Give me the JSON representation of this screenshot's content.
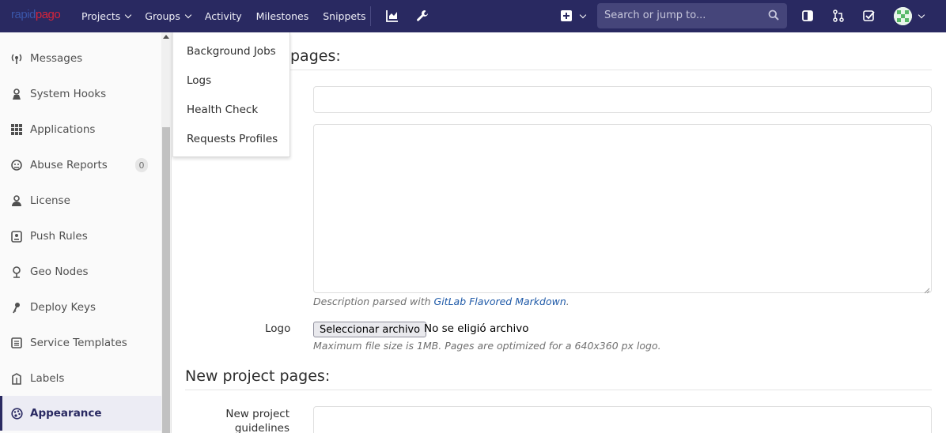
{
  "navbar": {
    "brand_prefix": "rapid",
    "brand_suffix": "pago",
    "items": [
      {
        "label": "Projects",
        "has_caret": true
      },
      {
        "label": "Groups",
        "has_caret": true
      },
      {
        "label": "Activity",
        "has_caret": false
      },
      {
        "label": "Milestones",
        "has_caret": false
      },
      {
        "label": "Snippets",
        "has_caret": false
      }
    ],
    "icons": [
      "chart-icon",
      "wrench-icon",
      "plus-square-icon",
      "chevron-down-icon",
      "sidebar-toggle-icon",
      "merge-request-icon",
      "todo-check-icon"
    ],
    "search_placeholder": "Search or jump to...",
    "colors": {
      "bg": "#292961",
      "search_bg": "#45457a"
    }
  },
  "sidebar": {
    "items": [
      {
        "label": "Messages",
        "icon": "broadcast-icon"
      },
      {
        "label": "System Hooks",
        "icon": "hook-icon"
      },
      {
        "label": "Applications",
        "icon": "grid-icon"
      },
      {
        "label": "Abuse Reports",
        "icon": "abuse-icon",
        "badge": "0"
      },
      {
        "label": "License",
        "icon": "license-icon"
      },
      {
        "label": "Push Rules",
        "icon": "push-rules-icon"
      },
      {
        "label": "Geo Nodes",
        "icon": "location-icon"
      },
      {
        "label": "Deploy Keys",
        "icon": "key-icon"
      },
      {
        "label": "Service Templates",
        "icon": "service-icon"
      },
      {
        "label": "Labels",
        "icon": "label-icon"
      },
      {
        "label": "Appearance",
        "icon": "palette-icon",
        "active": true
      }
    ]
  },
  "dropdown": {
    "items": [
      "Background Jobs",
      "Logs",
      "Health Check",
      "Requests Profiles"
    ]
  },
  "main": {
    "signin_title_visible": "pages:",
    "description_help_prefix": "Description parsed with ",
    "description_help_link": "GitLab Flavored Markdown",
    "description_help_suffix": ".",
    "logo_label": "Logo",
    "file_button": "Seleccionar archivo",
    "file_none": "No se eligió archivo",
    "logo_help": "Maximum file size is 1MB. Pages are optimized for a 640x360 px logo.",
    "new_project_title": "New project pages:",
    "guidelines_label_line1": "New project",
    "guidelines_label_line2": "guidelines"
  }
}
